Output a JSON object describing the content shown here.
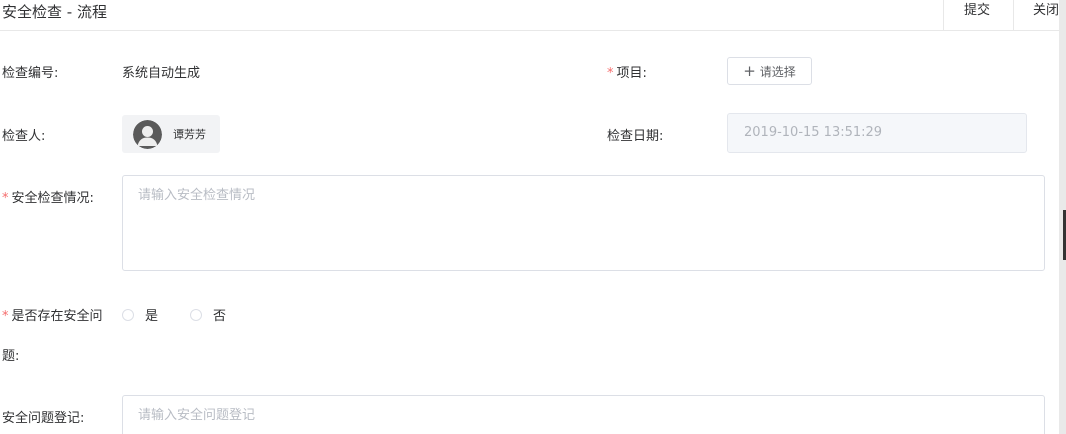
{
  "header": {
    "title": "安全检查 - 流程",
    "submit_label": "提交",
    "close_label": "关闭"
  },
  "form": {
    "required_mark": "*",
    "check_no": {
      "label": "检查编号:",
      "value": "系统自动生成"
    },
    "project": {
      "label": "项目:",
      "button_label": "请选择"
    },
    "inspector": {
      "label": "检查人:",
      "name": "谭芳芳"
    },
    "check_date": {
      "label": "检查日期:",
      "value": "2019-10-15 13:51:29"
    },
    "situation": {
      "label": "安全检查情况:",
      "placeholder": "请输入安全检查情况"
    },
    "has_issue": {
      "label_line1": "是否存在安全问",
      "label_line2": "题:",
      "options": [
        "是",
        "否"
      ]
    },
    "issue_register": {
      "label": "安全问题登记:",
      "placeholder": "请输入安全问题登记"
    }
  },
  "colors": {
    "required": "#f56c6c",
    "border": "#dcdfe6",
    "placeholder": "#b8bcc4",
    "disabled_bg": "#f5f7fa"
  }
}
